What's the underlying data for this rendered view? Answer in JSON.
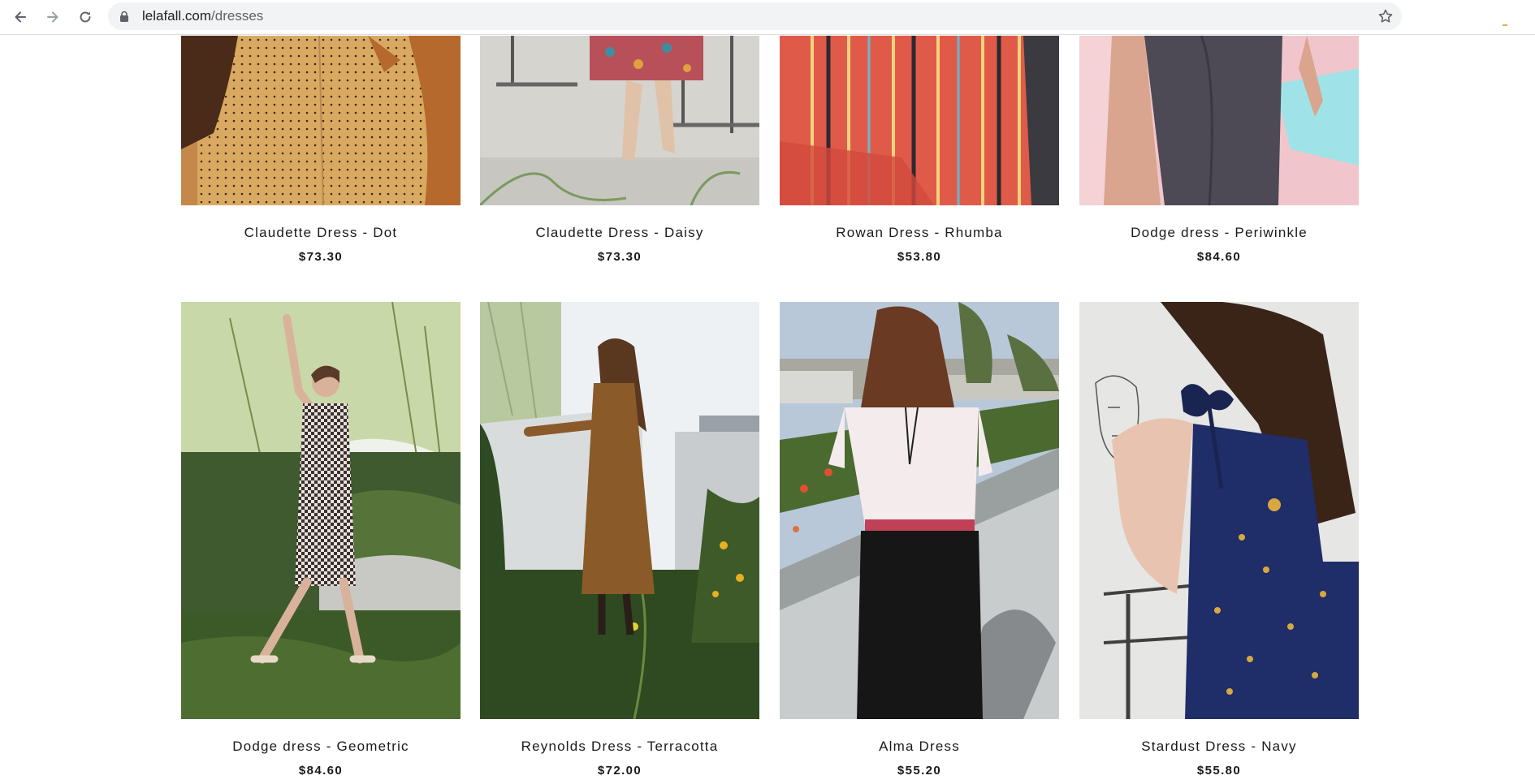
{
  "browser": {
    "url_host": "lelafall.com",
    "url_path": "/dresses",
    "icons": [
      "back-arrow-icon",
      "forward-arrow-icon",
      "reload-icon",
      "lock-icon",
      "bookmark-star-icon"
    ]
  },
  "products": [
    {
      "name": "Claudette Dress - Dot",
      "price": "$73.30"
    },
    {
      "name": "Claudette Dress - Daisy",
      "price": "$73.30"
    },
    {
      "name": "Rowan Dress - Rhumba",
      "price": "$53.80"
    },
    {
      "name": "Dodge dress - Periwinkle",
      "price": "$84.60"
    },
    {
      "name": "Dodge dress - Geometric",
      "price": "$84.60"
    },
    {
      "name": "Reynolds Dress - Terracotta",
      "price": "$72.00"
    },
    {
      "name": "Alma Dress",
      "price": "$55.20"
    },
    {
      "name": "Stardust Dress - Navy",
      "price": "$55.80"
    }
  ]
}
